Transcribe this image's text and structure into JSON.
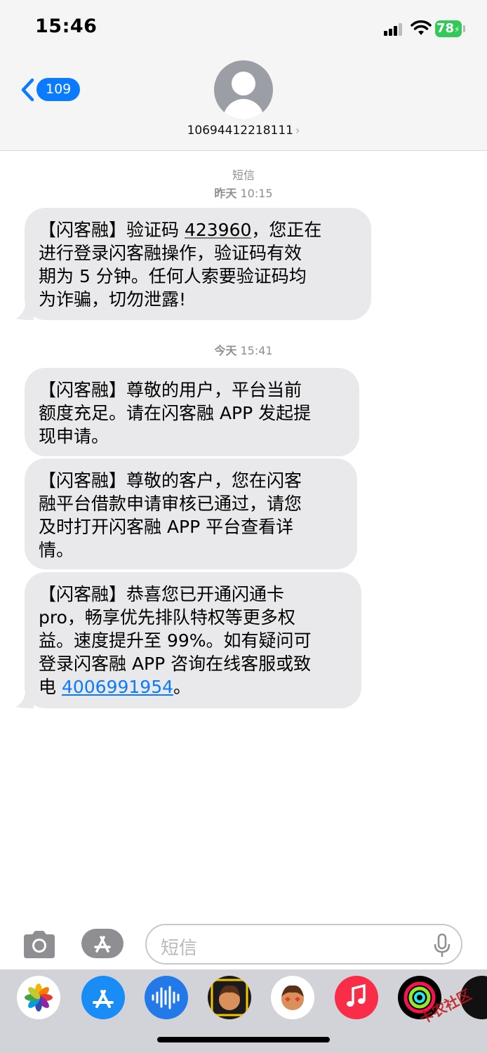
{
  "status_bar": {
    "time": "15:46",
    "battery": "78"
  },
  "header": {
    "back_count": "109",
    "contact_number": "10694412218111",
    "chevron": "›"
  },
  "thread": {
    "meta1_label": "短信",
    "meta1_time_day": "昨天",
    "meta1_time": " 10:15",
    "msg1_a": "【闪客融】验证码 ",
    "msg1_code": "423960",
    "msg1_b": "，您正在\n进行登录闪客融操作，验证码有效\n期为 5 分钟。任何人索要验证码均\n为诈骗，切勿泄露!",
    "meta2_time_day": "今天",
    "meta2_time": " 15:41",
    "msg2": "【闪客融】尊敬的用户，平台当前\n额度充足。请在闪客融 APP 发起提\n现申请。",
    "msg3": "【闪客融】尊敬的客户，您在闪客\n融平台借款申请审核已通过，请您\n及时打开闪客融 APP 平台查看详\n情。",
    "msg4_a": "【闪客融】恭喜您已开通闪通卡\npro，畅享优先排队特权等更多权\n益。速度提升至 99%。如有疑问可\n登录闪客融 APP 咨询在线客服或致\n电 ",
    "msg4_link": "4006991954",
    "msg4_b": "。"
  },
  "composer": {
    "placeholder": "短信"
  },
  "dock": [
    "photos-app",
    "app-store-app",
    "audio-messages-app",
    "memoji-app",
    "memoji-stickers-app",
    "music-app",
    "activity-app",
    "more-app"
  ],
  "watermark": "卡农社区",
  "colors": {
    "accent": "#0a7aff",
    "bubble": "#e9e9eb",
    "battery": "#34c759"
  }
}
